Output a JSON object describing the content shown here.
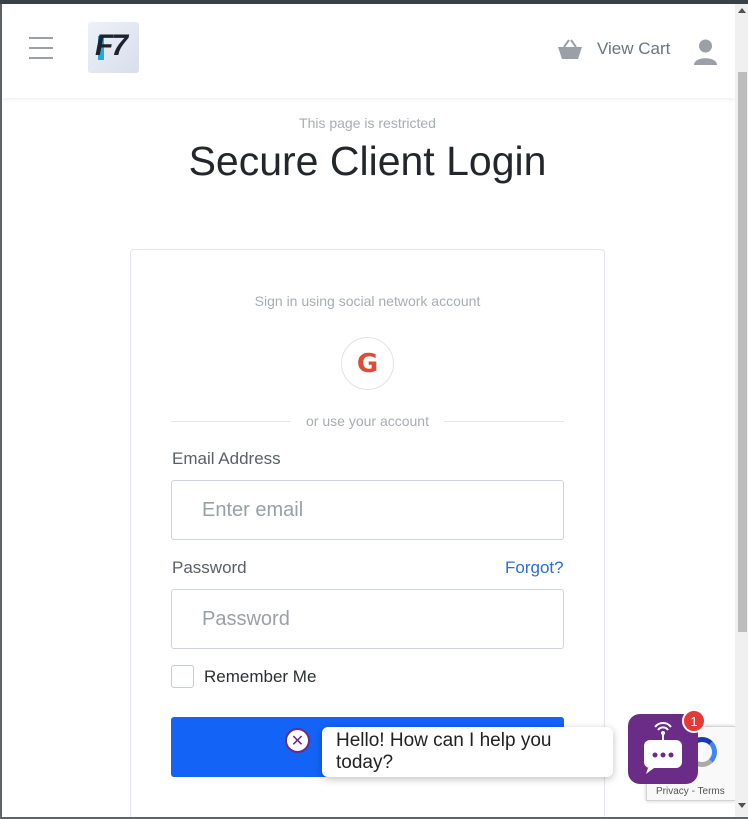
{
  "header": {
    "cart_label": "View Cart",
    "logo_text": "F7"
  },
  "main": {
    "restricted_note": "This page is restricted",
    "title": "Secure Client Login"
  },
  "login": {
    "social_text": "Sign in using social network account",
    "google_letter": "G",
    "divider_text": "or use your account",
    "email_label": "Email Address",
    "email_placeholder": "Enter email",
    "email_value": "",
    "password_label": "Password",
    "password_placeholder": "Password",
    "password_value": "",
    "forgot_label": "Forgot?",
    "remember_label": "Remember Me",
    "remember_checked": false
  },
  "chat": {
    "message": "Hello! How can I help you today?",
    "badge_count": "1"
  },
  "recaptcha": {
    "privacy": "Privacy",
    "separator": " - ",
    "terms": "Terms"
  },
  "colors": {
    "primary": "#1363f7",
    "link": "#2a6fd6",
    "chat_purple": "#6a2c86",
    "google_red": "#dd4b39"
  }
}
